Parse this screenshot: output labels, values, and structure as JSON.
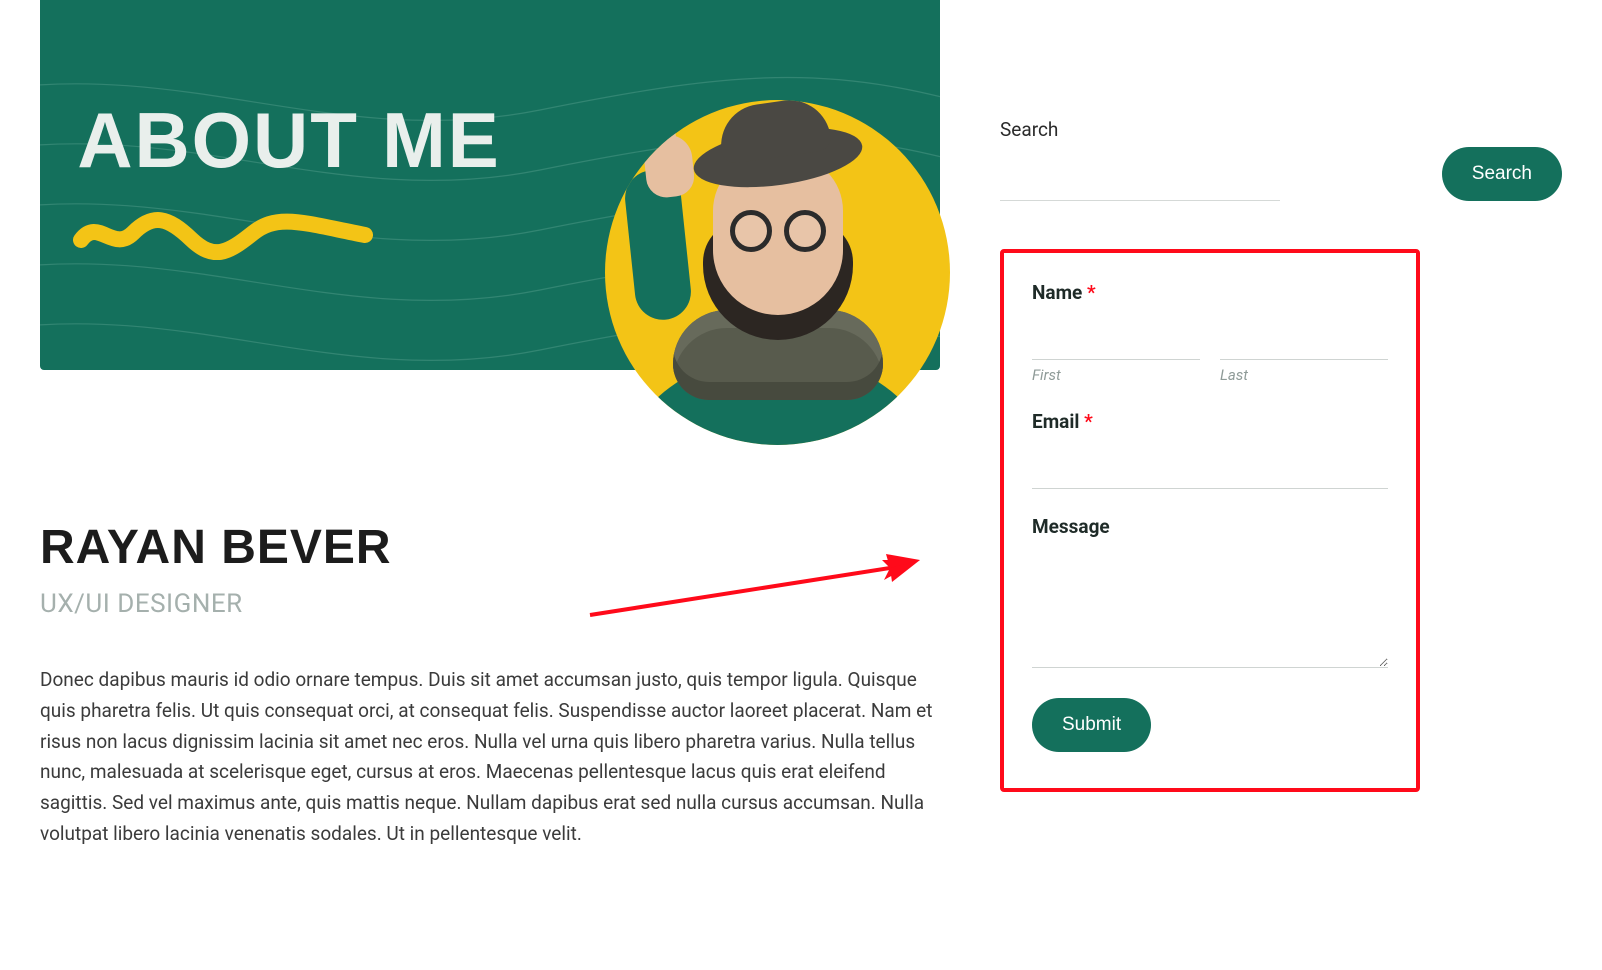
{
  "hero": {
    "title": "ABOUT ME"
  },
  "profile": {
    "name": "RAYAN BEVER",
    "role": "UX/UI DESIGNER",
    "bio": "Donec dapibus mauris id odio ornare tempus. Duis sit amet accumsan justo, quis tempor ligula. Quisque quis pharetra felis. Ut quis consequat orci, at consequat felis. Suspendisse auctor laoreet placerat. Nam et risus non lacus dignissim lacinia sit amet nec eros. Nulla vel urna quis libero pharetra varius. Nulla tellus nunc, malesuada at scelerisque eget, cursus at eros. Maecenas pellentesque lacus quis erat eleifend sagittis. Sed vel maximus ante, quis mattis neque. Nullam dapibus erat sed nulla cursus accumsan. Nulla volutpat libero lacinia venenatis sodales. Ut in pellentesque velit."
  },
  "sidebar": {
    "search_label": "Search",
    "search_button": "Search",
    "form": {
      "name_label": "Name",
      "first_sub": "First",
      "last_sub": "Last",
      "email_label": "Email",
      "message_label": "Message",
      "submit_label": "Submit",
      "required_marker": "*"
    }
  },
  "colors": {
    "teal": "#14705c",
    "yellow": "#f3c416",
    "annotation_red": "#ff0a1a"
  }
}
